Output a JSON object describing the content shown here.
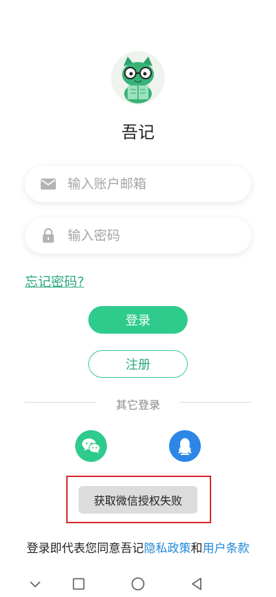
{
  "app": {
    "name": "吾记"
  },
  "login_form": {
    "email_placeholder": "输入账户邮箱",
    "password_placeholder": "输入密码",
    "forgot_password": "忘记密码?",
    "login_button": "登录",
    "register_button": "注册"
  },
  "other_login": {
    "label": "其它登录",
    "methods": [
      {
        "icon": "wechat-icon",
        "color": "#2ecb8d"
      },
      {
        "icon": "qq-icon",
        "color": "#2d86e6"
      }
    ]
  },
  "toast": {
    "message": "获取微信授权失败",
    "highlight_color": "#d8232a"
  },
  "agreement": {
    "prefix": "登录即代表您同意吾记",
    "privacy_link": "隐私政策",
    "conjunction": "和",
    "terms_link": "用户条款"
  },
  "colors": {
    "accent": "#2ecb8d",
    "link": "#1e8ad6",
    "qq": "#2d86e6"
  },
  "navigation_bar": {
    "buttons": [
      "chevron-down-icon",
      "square-icon",
      "circle-icon",
      "triangle-back-icon"
    ]
  }
}
